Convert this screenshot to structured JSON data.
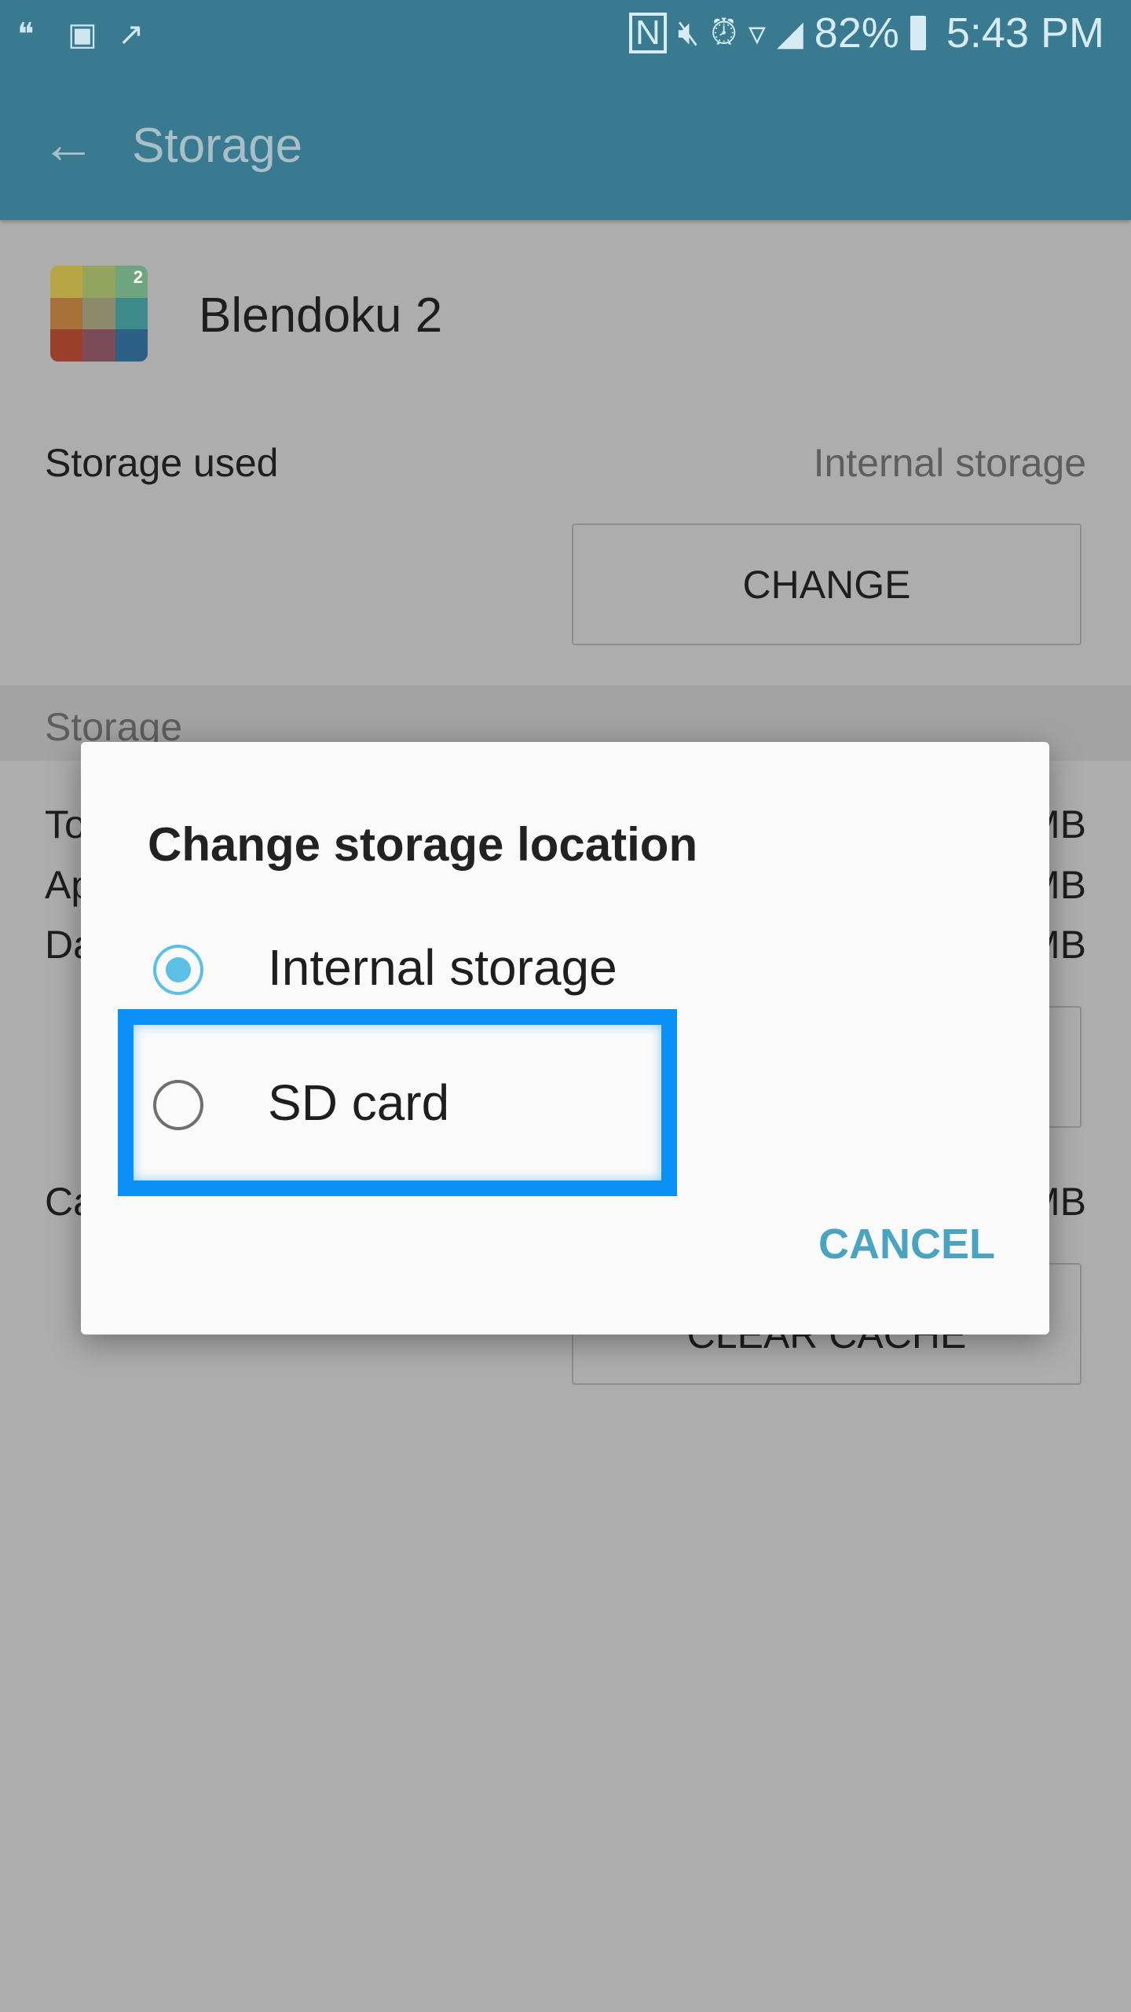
{
  "status_bar": {
    "left_icons": [
      "hangouts-icon",
      "gallery-icon",
      "trending-icon"
    ],
    "right_icons": [
      "nfc-icon",
      "mute-icon",
      "alarm-icon",
      "wifi-icon",
      "signal-icon",
      "battery-icon"
    ],
    "battery": "82%",
    "time": "5:43 PM"
  },
  "app_bar": {
    "title": "Storage",
    "back_icon": "arrow-left-icon"
  },
  "app": {
    "name": "Blendoku 2",
    "badge": "2"
  },
  "storage_used": {
    "label": "Storage used",
    "value": "Internal storage",
    "change_label": "CHANGE"
  },
  "storage_section": {
    "header": "Storage",
    "rows": [
      {
        "label": "To",
        "unit": "MB"
      },
      {
        "label": "Ap",
        "unit": "MB"
      },
      {
        "label": "Da",
        "unit": "MB"
      }
    ],
    "cache_row": {
      "label": "Ca",
      "unit": "MB"
    },
    "clear_cache_label": "CLEAR CACHE"
  },
  "dialog": {
    "title": "Change storage location",
    "options": [
      {
        "label": "Internal storage",
        "selected": true
      },
      {
        "label": "SD card",
        "selected": false
      }
    ],
    "cancel_label": "CANCEL"
  },
  "colors": {
    "app_bar": "#3a7a91",
    "accent": "#4aa3bf",
    "radio_selected": "#5bbfe6",
    "highlight": "#0a90f6"
  }
}
